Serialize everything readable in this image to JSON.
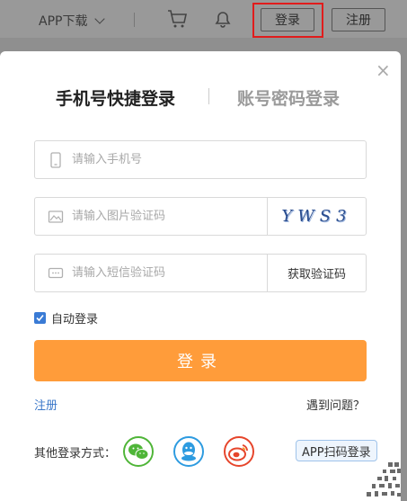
{
  "topbar": {
    "app_download": "APP下载",
    "login_label": "登录",
    "register_label": "注册",
    "cart_icon": "cart-icon",
    "bell_icon": "bell-icon"
  },
  "modal": {
    "tabs": [
      {
        "label": "手机号快捷登录",
        "active": true
      },
      {
        "label": "账号密码登录",
        "active": false
      }
    ],
    "phone_field": {
      "placeholder": "请输入手机号",
      "icon": "phone-icon"
    },
    "captcha_field": {
      "placeholder": "请输入图片验证码",
      "icon": "image-icon",
      "captcha_text": "YWS3"
    },
    "sms_field": {
      "placeholder": "请输入短信验证码",
      "icon": "sms-icon",
      "get_code_label": "获取验证码"
    },
    "auto_login": {
      "label": "自动登录",
      "checked": true
    },
    "submit_label": "登录",
    "register_link": "注册",
    "help_link": "遇到问题？",
    "other_login_label": "其他登录方式：",
    "social": [
      "wechat-icon",
      "qq-icon",
      "weibo-icon"
    ],
    "app_scan_label": "APP扫码登录"
  },
  "colors": {
    "accent_orange": "#ff9c3a",
    "link_blue": "#3b78c9",
    "highlight_red": "#e11c1c",
    "checkbox_blue": "#3a7bd5"
  }
}
